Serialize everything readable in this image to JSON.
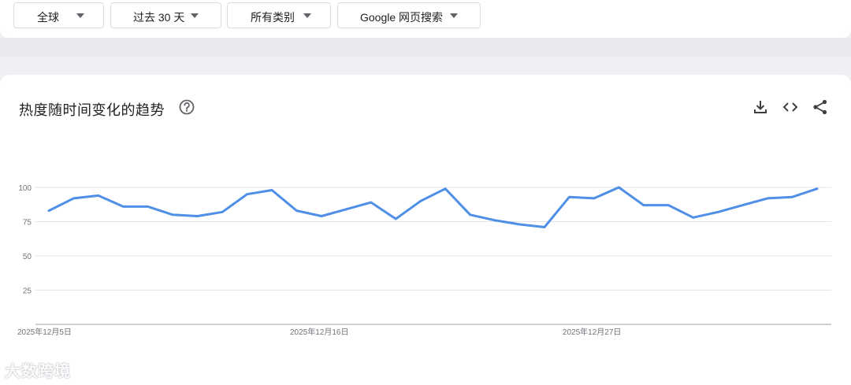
{
  "filters": {
    "region": "全球",
    "time_range": "过去 30 天",
    "category": "所有类别",
    "search_type": "Google 网页搜索"
  },
  "card": {
    "title": "热度随时间变化的趋势"
  },
  "icons": {
    "help": "help-circle-icon",
    "download": "download-icon",
    "embed": "code-embed-icon",
    "share": "share-icon"
  },
  "colors": {
    "line": "#4f8fe6",
    "grid": "#e3e3e3",
    "axis": "#9aa0a6",
    "label": "#70757a"
  },
  "chart_data": {
    "type": "line",
    "title": "",
    "xlabel": "",
    "ylabel": "",
    "ylim": [
      0,
      100
    ],
    "y_ticks": [
      25,
      50,
      75,
      100
    ],
    "x_tick_labels": [
      {
        "index": 0,
        "label": "2025年12月5日"
      },
      {
        "index": 11,
        "label": "2025年12月16日"
      },
      {
        "index": 22,
        "label": "2025年12月27日"
      }
    ],
    "grid": true,
    "series": [
      {
        "values": [
          83,
          92,
          94,
          86,
          86,
          80,
          79,
          82,
          95,
          98,
          83,
          79,
          84,
          89,
          77,
          90,
          99,
          80,
          76,
          73,
          71,
          93,
          92,
          100,
          87,
          87,
          78,
          82,
          87,
          92,
          93,
          99
        ]
      }
    ]
  },
  "watermark": "大数跨境"
}
